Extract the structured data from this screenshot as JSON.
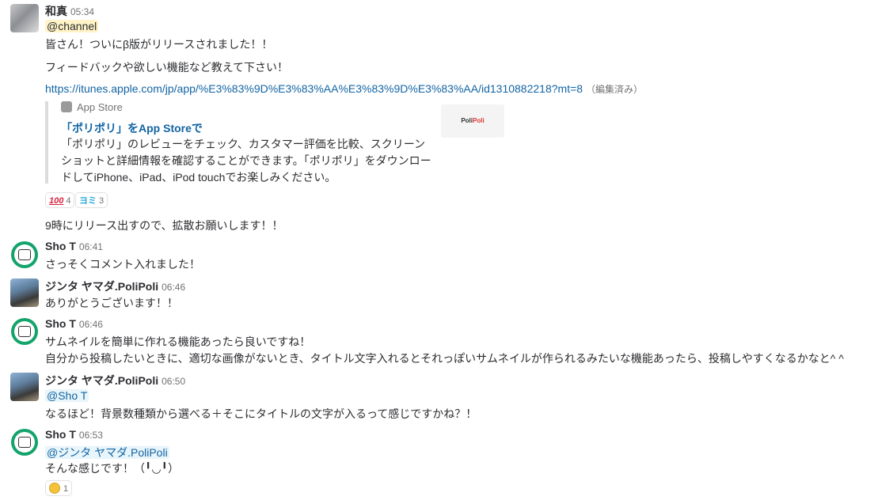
{
  "messages": {
    "m1": {
      "author": "和真",
      "time": "05:34",
      "mention": "@channel",
      "line1": "皆さん！ついにβ版がリリースされました！！",
      "line2": "フィードバックや欲しい機能など教えて下さい！",
      "url": "https://itunes.apple.com/jp/app/%E3%83%9D%E3%83%AA%E3%83%9D%E3%83%AA/id1310882218?mt=8",
      "edited": "（編集済み）",
      "attachment": {
        "source": "App Store",
        "title": "「ポリポリ」をApp Storeで",
        "description": "「ポリポリ」のレビューをチェック、カスタマー評価を比較、スクリーンショットと詳細情報を確認することができます。「ポリポリ」をダウンロードしてiPhone、iPad、iPod touchでお楽しみください。",
        "thumb_text_a": "Poli",
        "thumb_text_b": "Poli"
      },
      "reactions": [
        {
          "emoji": "100",
          "count": "4"
        },
        {
          "emoji": "ok-icon",
          "count": "3"
        }
      ],
      "line3": "9時にリリース出すので、拡散お願いします！！"
    },
    "m2": {
      "author": "Sho T",
      "time": "06:41",
      "line1": "さっそくコメント入れました！"
    },
    "m3": {
      "author": "ジンタ ヤマダ.PoliPoli",
      "time": "06:46",
      "line1": "ありがとうございます！！"
    },
    "m4": {
      "author": "Sho T",
      "time": "06:46",
      "line1": "サムネイルを簡単に作れる機能あったら良いですね！",
      "line2": "自分から投稿したいときに、適切な画像がないとき、タイトル文字入れるとそれっぽいサムネイルが作られるみたいな機能あったら、投稿しやすくなるかなと^ ^"
    },
    "m5": {
      "author": "ジンタ ヤマダ.PoliPoli",
      "time": "06:50",
      "mention": "@Sho T",
      "line1": "なるほど！背景数種類から選べる＋そこにタイトルの文字が入るって感じですかね？！"
    },
    "m6": {
      "author": "Sho T",
      "time": "06:53",
      "mention": "@ジンタ ヤマダ.PoliPoli",
      "line1": "そんな感じです！（╹◡╹）",
      "reactions": [
        {
          "emoji": "smile-face-icon",
          "count": "1"
        }
      ]
    }
  }
}
